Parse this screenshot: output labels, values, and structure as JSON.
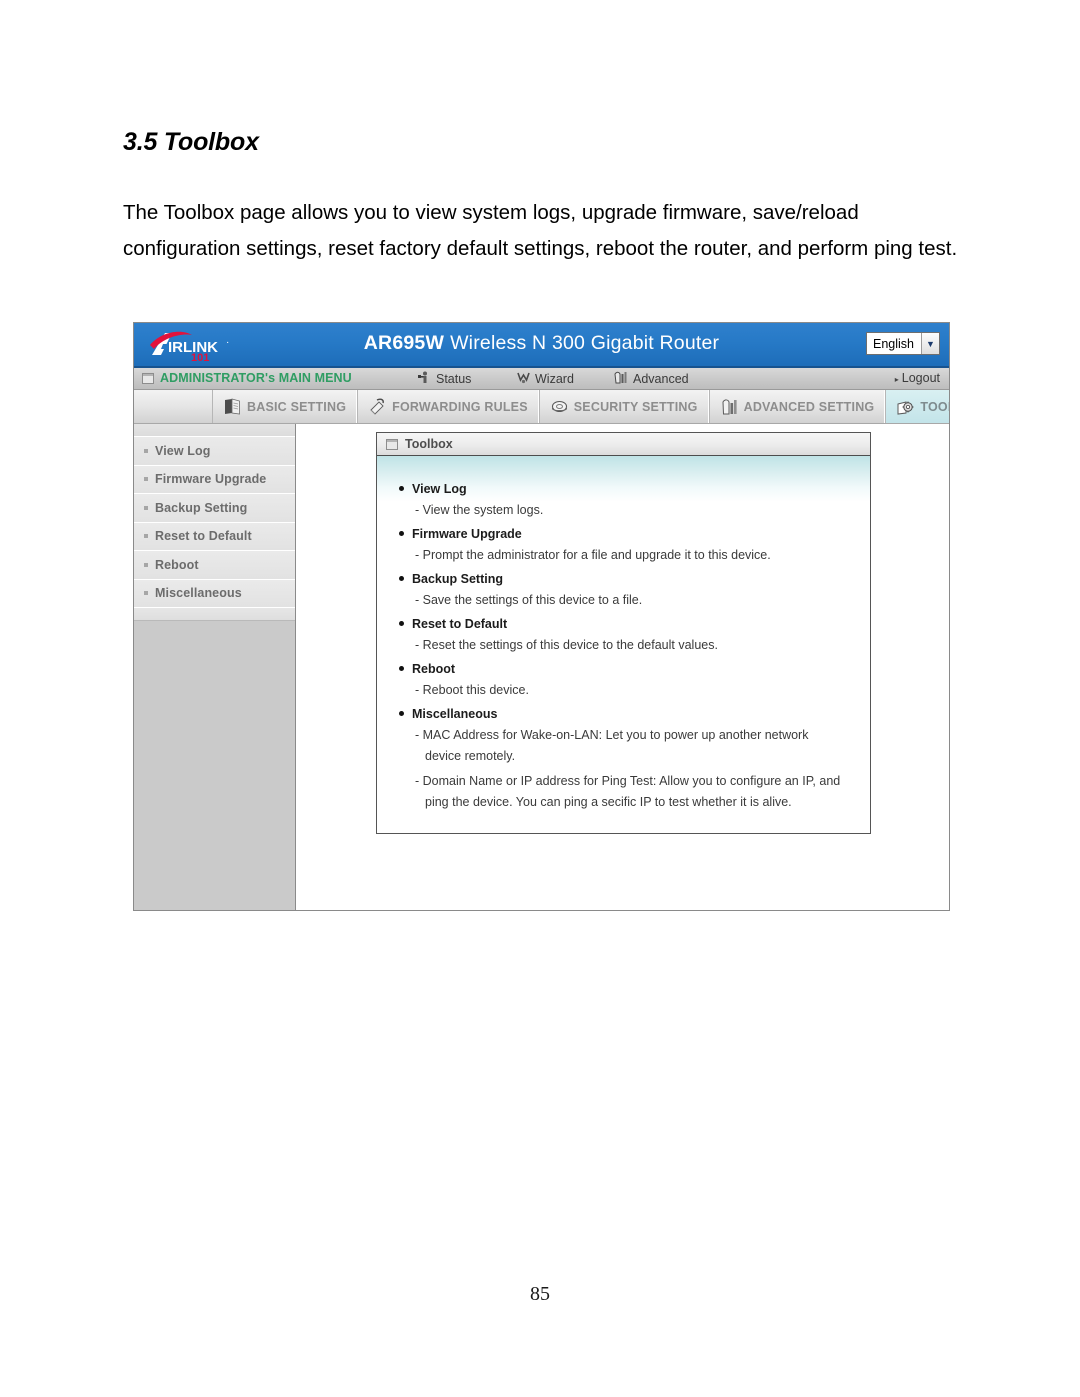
{
  "document": {
    "heading": "3.5 Toolbox",
    "paragraph": "The Toolbox page allows you to view system logs, upgrade firmware, save/reload configuration settings, reset factory default settings, reboot the router, and perform ping test.",
    "page_number": "85"
  },
  "router_ui": {
    "brand": {
      "logo_main": "AIRLINK",
      "logo_sub": "101",
      "logo_trademark": "·"
    },
    "title": {
      "model": "AR695W",
      "description": "Wireless N 300 Gigabit Router"
    },
    "language": {
      "selected": "English",
      "arrow": "▼"
    },
    "admin_bar": {
      "main_menu_label": "ADMINISTRATOR's MAIN MENU",
      "items": [
        {
          "label": "Status",
          "icon": "status-icon"
        },
        {
          "label": "Wizard",
          "icon": "wizard-icon"
        },
        {
          "label": "Advanced",
          "icon": "advanced-icon"
        }
      ],
      "logout_label": "Logout",
      "logout_caret": "▸"
    },
    "tabs": [
      {
        "label": "BASIC SETTING",
        "icon": "basic-setting-icon",
        "active": false
      },
      {
        "label": "FORWARDING RULES",
        "icon": "forwarding-rules-icon",
        "active": false
      },
      {
        "label": "SECURITY SETTING",
        "icon": "security-setting-icon",
        "active": false
      },
      {
        "label": "ADVANCED SETTING",
        "icon": "advanced-setting-icon",
        "active": false
      },
      {
        "label": "TOOLBOX",
        "icon": "toolbox-icon",
        "active": true
      }
    ],
    "sidebar": {
      "items": [
        {
          "label": "View Log"
        },
        {
          "label": "Firmware Upgrade"
        },
        {
          "label": "Backup Setting"
        },
        {
          "label": "Reset to Default"
        },
        {
          "label": "Reboot"
        },
        {
          "label": "Miscellaneous"
        }
      ]
    },
    "panel": {
      "title": "Toolbox",
      "entries": [
        {
          "title": "View Log",
          "descriptions": [
            "- View the system logs."
          ]
        },
        {
          "title": "Firmware Upgrade",
          "descriptions": [
            "- Prompt the administrator for a file and upgrade it to this device."
          ]
        },
        {
          "title": "Backup Setting",
          "descriptions": [
            "- Save the settings of this device to a file."
          ]
        },
        {
          "title": "Reset to Default",
          "descriptions": [
            "- Reset the settings of this device to the default values."
          ]
        },
        {
          "title": "Reboot",
          "descriptions": [
            "- Reboot this device."
          ]
        },
        {
          "title": "Miscellaneous",
          "descriptions": [
            "- MAC Address for Wake-on-LAN: Let you to power up another network device remotely.",
            "- Domain Name or IP address for Ping Test: Allow you to configure an IP, and ping the device. You can ping a secific IP to test whether it is alive."
          ]
        }
      ]
    }
  },
  "colors": {
    "header_blue": "#2679c6",
    "brand_red": "#e2123c",
    "active_tab_cyan": "#c3e4e9",
    "menu_green": "#2f9d63",
    "sidebar_gray": "#cacaca"
  }
}
